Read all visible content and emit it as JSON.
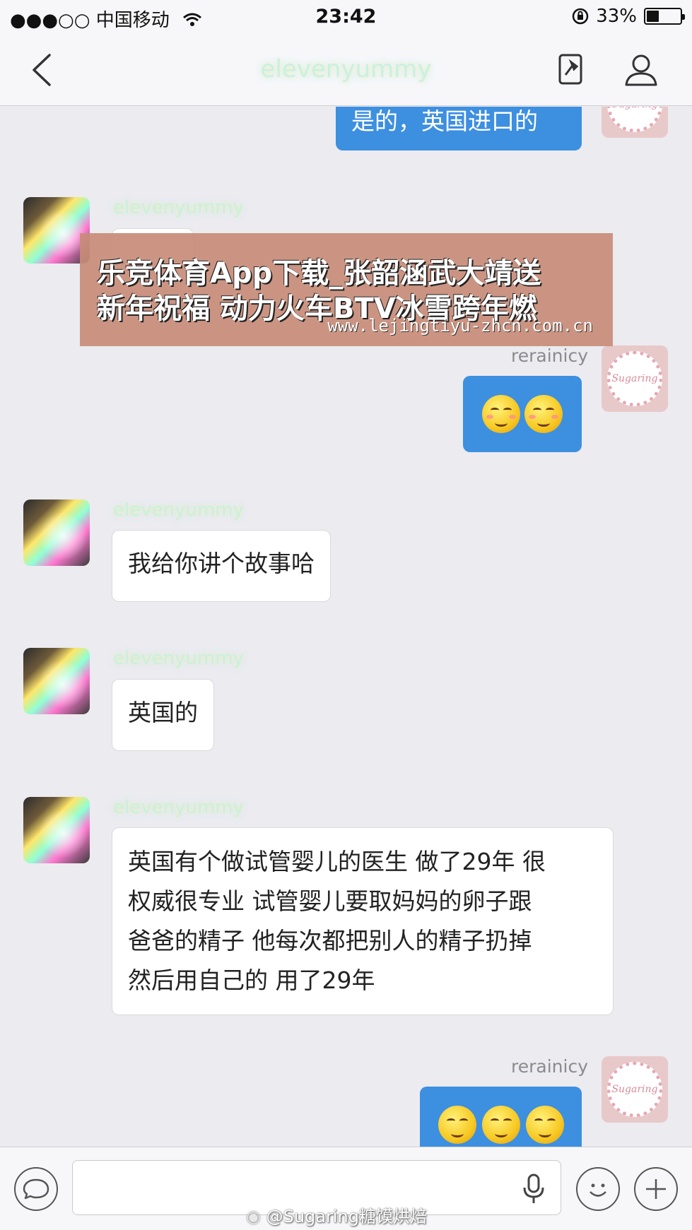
{
  "status_bar": {
    "signal": "●●●○○",
    "carrier": "中国移动",
    "time": "23:42",
    "battery": "33%",
    "battery_level": 0.33
  },
  "nav": {
    "title": "elevenyummy"
  },
  "messages": [
    {
      "from": "me",
      "text": "是的，英国进口的"
    },
    {
      "from": "other",
      "name": "elevenyummy",
      "text": ""
    },
    {
      "from": "me",
      "name": "rerainicy",
      "emoji_count": 2
    },
    {
      "from": "other",
      "name": "elevenyummy",
      "text": "我给你讲个故事哈"
    },
    {
      "from": "other",
      "name": "elevenyummy",
      "text": "英国的"
    },
    {
      "from": "other",
      "name": "elevenyummy",
      "lines": [
        "英国有个做试管婴儿的医生 做了29年 很",
        "权威很专业 试管婴儿要取妈妈的卵子跟",
        "爸爸的精子 他每次都把别人的精子扔掉",
        "然后用自己的 用了29年"
      ]
    },
    {
      "from": "me",
      "name": "rerainicy",
      "emoji_count": 3
    }
  ],
  "avatar_me_label": "Sugaring",
  "banner": {
    "line1": "乐竞体育App下载_张韶涵武大靖送",
    "line2": "新年祝福 动力火车BTV冰雪跨年燃",
    "url": "www.lejingtiyu-zhcn.com.cn"
  },
  "watermark": "@Sugaring糖馍烘焙"
}
